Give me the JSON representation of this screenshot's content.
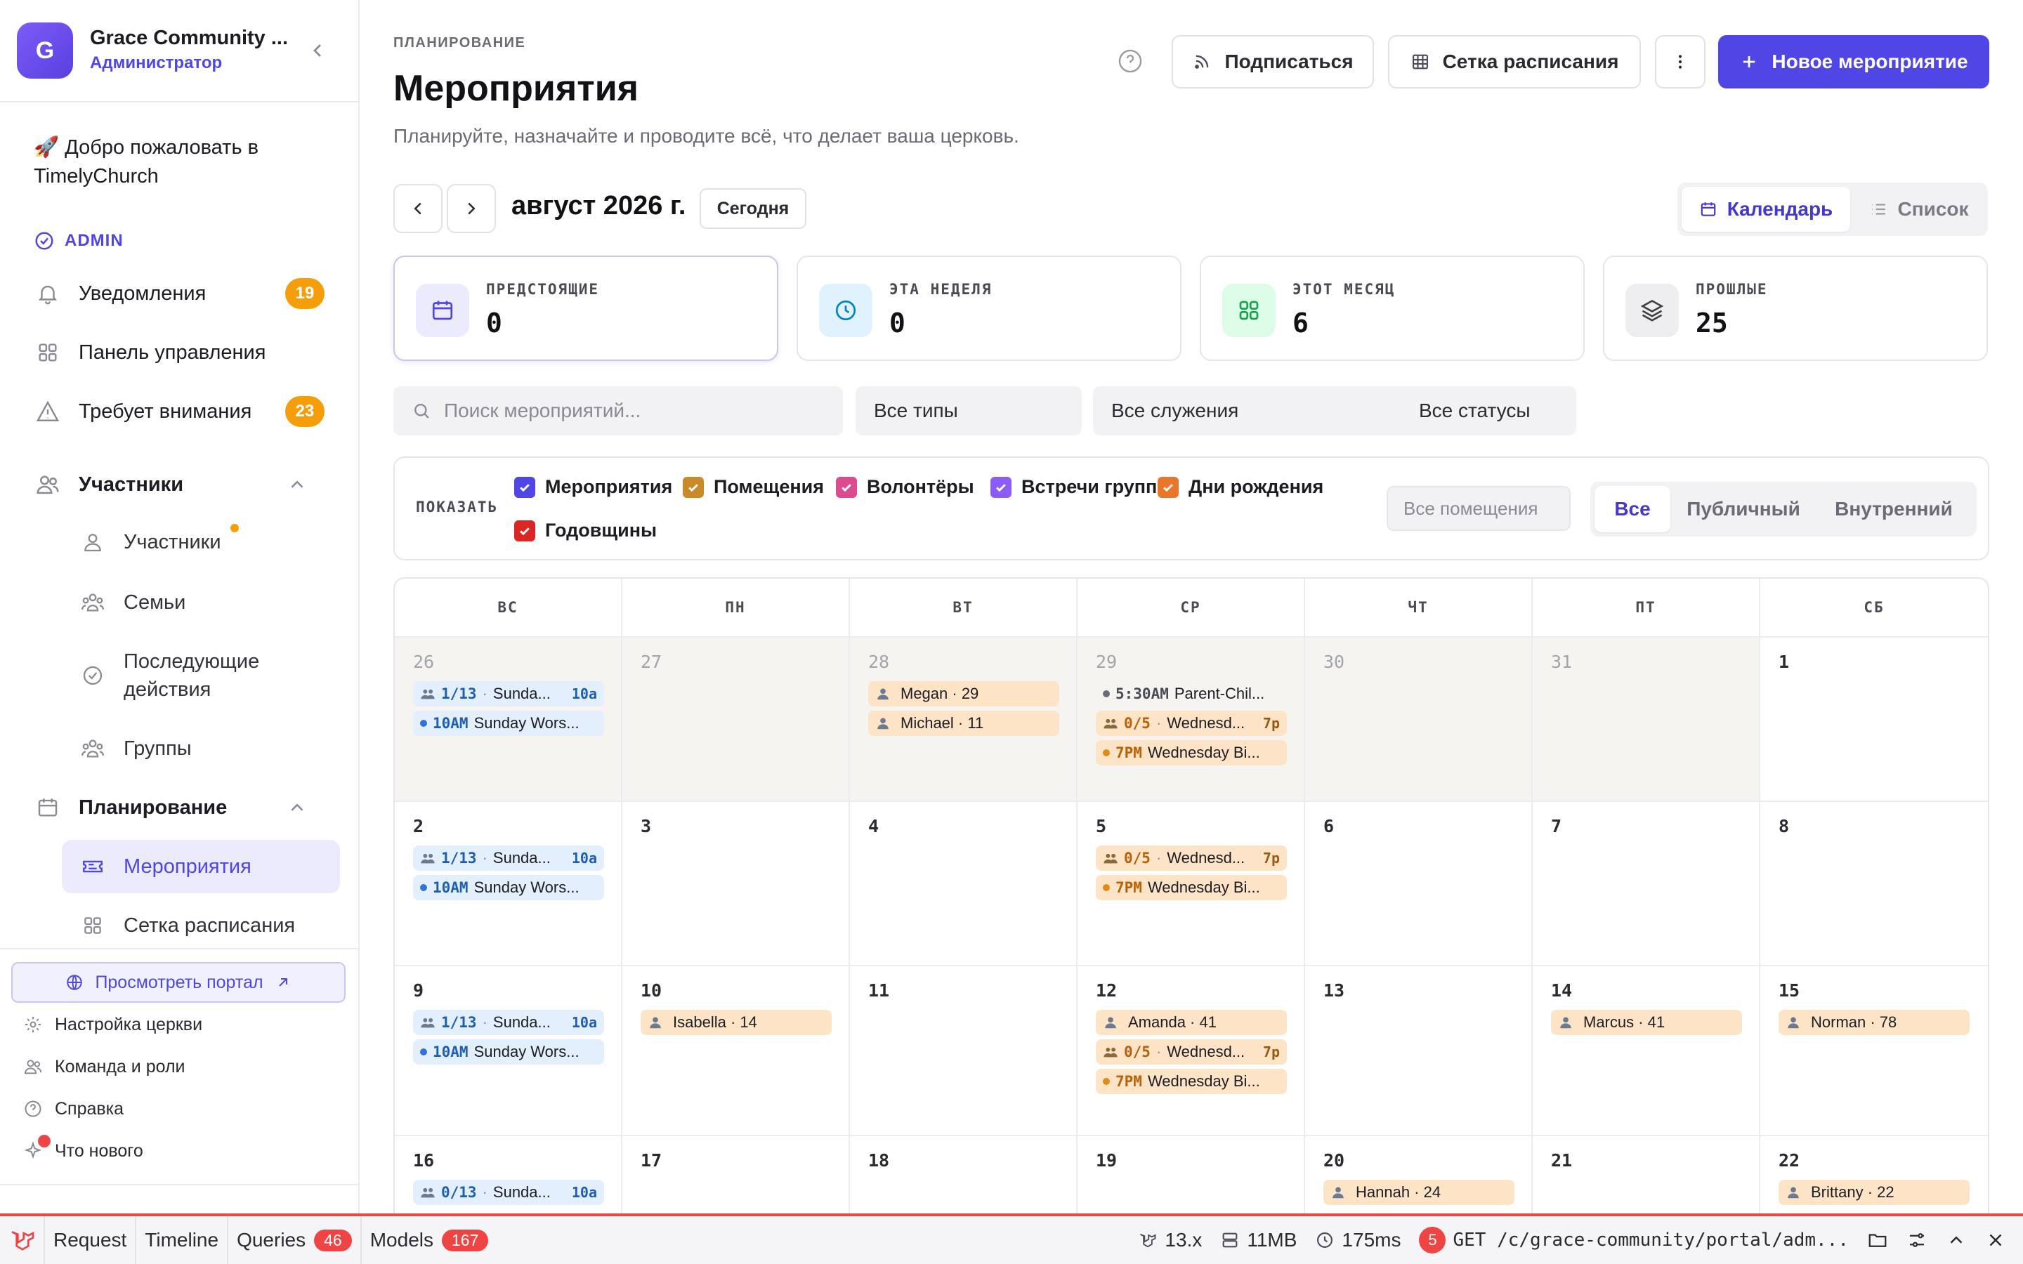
{
  "sidebar": {
    "workspace": {
      "initial": "G",
      "name": "Grace Community ...",
      "role": "Администратор"
    },
    "welcome": "🚀 Добро пожаловать в TimelyChurch",
    "admin_label": "ADMIN",
    "nav": [
      {
        "label": "Уведомления",
        "badge": "19"
      },
      {
        "label": "Панель управления"
      },
      {
        "label": "Требует внимания",
        "badge": "23"
      }
    ],
    "members_section": "Участники",
    "members_items": [
      "Участники",
      "Семьи",
      "Последующие действия",
      "Группы"
    ],
    "planning_section": "Планирование",
    "planning_items": [
      "Мероприятия",
      "Сетка расписания"
    ],
    "portal_button": "Просмотреть портал",
    "footer": [
      "Настройка церкви",
      "Команда и роли",
      "Справка",
      "Что нового"
    ]
  },
  "header": {
    "eyebrow": "ПЛАНИРОВАНИЕ",
    "title": "Мероприятия",
    "subtitle": "Планируйте, назначайте и проводите всё, что делает ваша церковь.",
    "subscribe": "Подписаться",
    "schedule_grid": "Сетка расписания",
    "new_event": "Новое мероприятие"
  },
  "toolbar": {
    "month": "август 2026 г.",
    "today": "Сегодня",
    "view_calendar": "Календарь",
    "view_list": "Список"
  },
  "stats": [
    {
      "label": "ПРЕДСТОЯЩИЕ",
      "value": "0"
    },
    {
      "label": "ЭТА НЕДЕЛЯ",
      "value": "0"
    },
    {
      "label": "ЭТОТ МЕСЯЦ",
      "value": "6"
    },
    {
      "label": "ПРОШЛЫЕ",
      "value": "25"
    }
  ],
  "filters": {
    "search_placeholder": "Поиск мероприятий...",
    "types": "Все типы",
    "ministries": "Все служения",
    "statuses": "Все статусы"
  },
  "show": {
    "label": "ПОКАЗАТЬ",
    "options": [
      {
        "label": "Мероприятия",
        "color": "#4f46e5"
      },
      {
        "label": "Помещения",
        "color": "#c98a2a"
      },
      {
        "label": "Волонтёры",
        "color": "#db4b8f"
      },
      {
        "label": "Встречи групп",
        "color": "#8b5cf6"
      },
      {
        "label": "Дни рождения",
        "color": "#e8762b"
      },
      {
        "label": "Годовщины",
        "color": "#dc2626"
      }
    ],
    "rooms_placeholder": "Все помещения",
    "visibility": [
      "Все",
      "Публичный",
      "Внутренний"
    ]
  },
  "calendar": {
    "weekdays": [
      "ВС",
      "ПН",
      "ВТ",
      "СР",
      "ЧТ",
      "ПТ",
      "СБ"
    ],
    "weeks": [
      [
        {
          "day": "26",
          "out": true,
          "events": [
            {
              "kind": "group",
              "color": "blue",
              "code": "1/13",
              "title": "Sunda...",
              "time": "10a"
            },
            {
              "kind": "dot",
              "color": "blue",
              "code": "10AM",
              "title": "Sunday Wors..."
            }
          ]
        },
        {
          "day": "27",
          "out": true,
          "events": []
        },
        {
          "day": "28",
          "out": true,
          "events": [
            {
              "kind": "person",
              "title": "Megan · 29"
            },
            {
              "kind": "person",
              "title": "Michael · 11"
            }
          ]
        },
        {
          "day": "29",
          "out": true,
          "events": [
            {
              "kind": "plain",
              "code": "5:30AM",
              "title": "Parent-Chil..."
            },
            {
              "kind": "group",
              "color": "peach",
              "code": "0/5",
              "title": "Wednesd...",
              "time": "7p"
            },
            {
              "kind": "dot",
              "color": "peach",
              "code": "7PM",
              "title": "Wednesday Bi..."
            }
          ]
        },
        {
          "day": "30",
          "out": true,
          "events": []
        },
        {
          "day": "31",
          "out": true,
          "events": []
        },
        {
          "day": "1",
          "out": false,
          "events": []
        }
      ],
      [
        {
          "day": "2",
          "out": false,
          "events": [
            {
              "kind": "group",
              "color": "blue",
              "code": "1/13",
              "title": "Sunda...",
              "time": "10a"
            },
            {
              "kind": "dot",
              "color": "blue",
              "code": "10AM",
              "title": "Sunday Wors..."
            }
          ]
        },
        {
          "day": "3",
          "out": false,
          "events": []
        },
        {
          "day": "4",
          "out": false,
          "events": []
        },
        {
          "day": "5",
          "out": false,
          "events": [
            {
              "kind": "group",
              "color": "peach",
              "code": "0/5",
              "title": "Wednesd...",
              "time": "7p"
            },
            {
              "kind": "dot",
              "color": "peach",
              "code": "7PM",
              "title": "Wednesday Bi..."
            }
          ]
        },
        {
          "day": "6",
          "out": false,
          "events": []
        },
        {
          "day": "7",
          "out": false,
          "events": []
        },
        {
          "day": "8",
          "out": false,
          "events": []
        }
      ],
      [
        {
          "day": "9",
          "out": false,
          "events": [
            {
              "kind": "group",
              "color": "blue",
              "code": "1/13",
              "title": "Sunda...",
              "time": "10a"
            },
            {
              "kind": "dot",
              "color": "blue",
              "code": "10AM",
              "title": "Sunday Wors..."
            }
          ]
        },
        {
          "day": "10",
          "out": false,
          "events": [
            {
              "kind": "person",
              "title": "Isabella · 14"
            }
          ]
        },
        {
          "day": "11",
          "out": false,
          "events": []
        },
        {
          "day": "12",
          "out": false,
          "events": [
            {
              "kind": "person",
              "title": "Amanda · 41"
            },
            {
              "kind": "group",
              "color": "peach",
              "code": "0/5",
              "title": "Wednesd...",
              "time": "7p"
            },
            {
              "kind": "dot",
              "color": "peach",
              "code": "7PM",
              "title": "Wednesday Bi..."
            }
          ]
        },
        {
          "day": "13",
          "out": false,
          "events": []
        },
        {
          "day": "14",
          "out": false,
          "events": [
            {
              "kind": "person",
              "title": "Marcus · 41"
            }
          ]
        },
        {
          "day": "15",
          "out": false,
          "events": [
            {
              "kind": "person",
              "title": "Norman · 78"
            }
          ]
        }
      ],
      [
        {
          "day": "16",
          "out": false,
          "events": [
            {
              "kind": "group",
              "color": "blue",
              "code": "0/13",
              "title": "Sunda...",
              "time": "10a"
            }
          ]
        },
        {
          "day": "17",
          "out": false,
          "events": []
        },
        {
          "day": "18",
          "out": false,
          "events": []
        },
        {
          "day": "19",
          "out": false,
          "events": []
        },
        {
          "day": "20",
          "out": false,
          "events": [
            {
              "kind": "person",
              "title": "Hannah · 24"
            }
          ]
        },
        {
          "day": "21",
          "out": false,
          "events": []
        },
        {
          "day": "22",
          "out": false,
          "events": [
            {
              "kind": "person",
              "title": "Brittany · 22"
            }
          ]
        }
      ]
    ]
  },
  "debugbar": {
    "tabs": [
      {
        "label": "Request"
      },
      {
        "label": "Timeline"
      },
      {
        "label": "Queries",
        "badge": "46"
      },
      {
        "label": "Models",
        "badge": "167"
      }
    ],
    "version": "13.x",
    "memory": "11MB",
    "time": "175ms",
    "requests": "5",
    "route": "GET /c/grace-community/portal/adm..."
  }
}
